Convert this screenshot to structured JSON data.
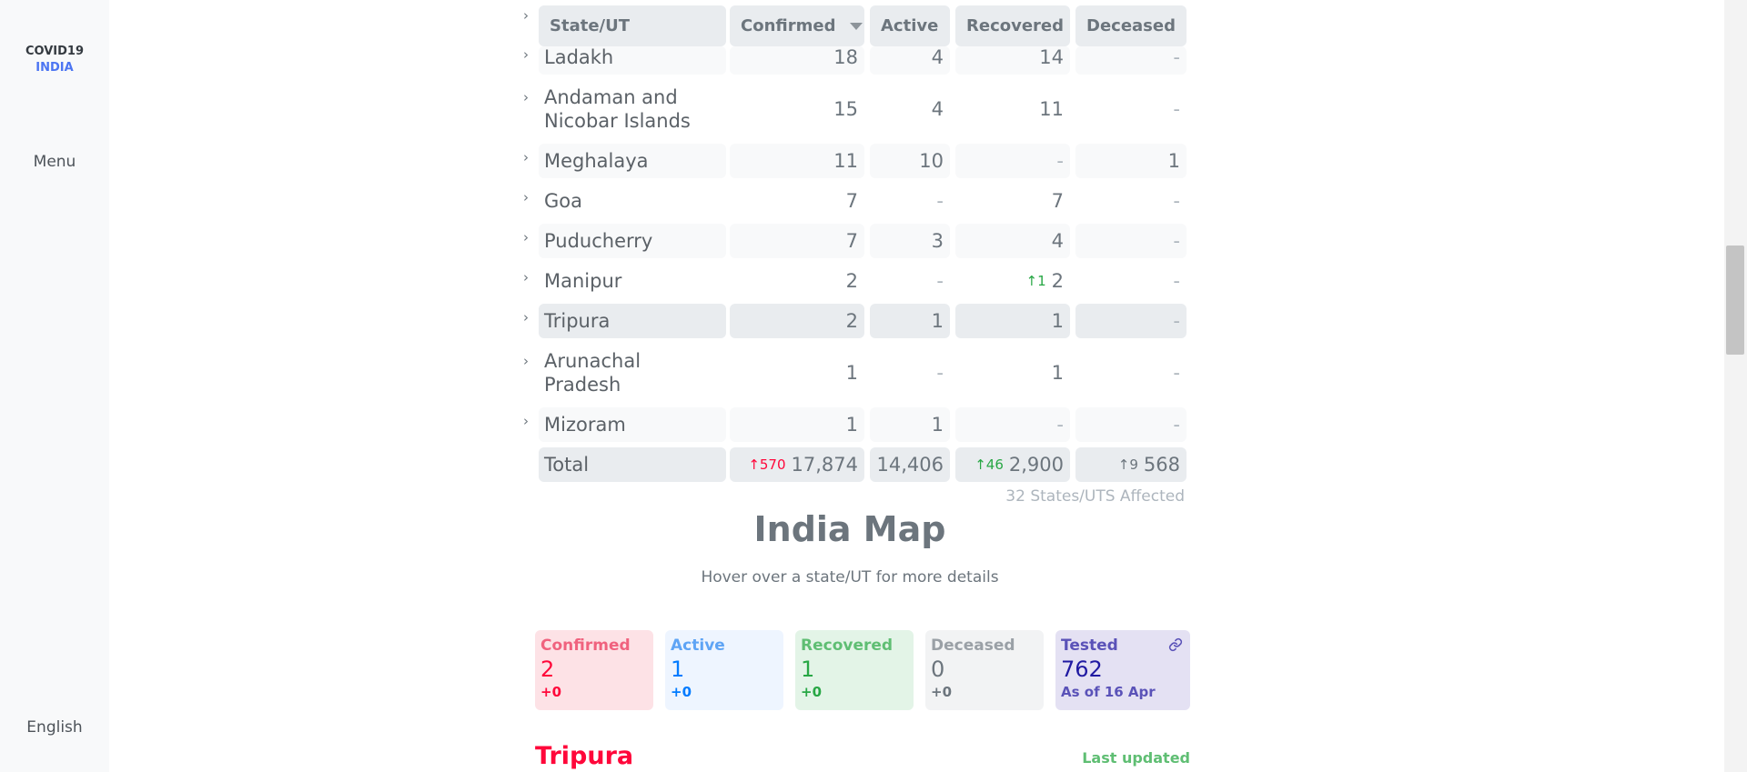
{
  "sidebar": {
    "brand_line1": "COVID19",
    "brand_line2": "INDIA",
    "menu_label": "Menu",
    "language_label": "English"
  },
  "table": {
    "headers": {
      "state": "State/UT",
      "confirmed": "Confirmed",
      "active": "Active",
      "recovered": "Recovered",
      "deceased": "Deceased"
    },
    "rows": [
      {
        "state": "Ladakh",
        "confirmed": "18",
        "active": "4",
        "recovered": "14",
        "deceased": "-"
      },
      {
        "state": "Andaman and Nicobar Islands",
        "confirmed": "15",
        "active": "4",
        "recovered": "11",
        "deceased": "-"
      },
      {
        "state": "Meghalaya",
        "confirmed": "11",
        "active": "10",
        "recovered": "-",
        "deceased": "1"
      },
      {
        "state": "Goa",
        "confirmed": "7",
        "active": "-",
        "recovered": "7",
        "deceased": "-"
      },
      {
        "state": "Puducherry",
        "confirmed": "7",
        "active": "3",
        "recovered": "4",
        "deceased": "-"
      },
      {
        "state": "Manipur",
        "confirmed": "2",
        "active": "-",
        "recovered": "2",
        "recovered_delta": "↑1",
        "deceased": "-"
      },
      {
        "state": "Tripura",
        "confirmed": "2",
        "active": "1",
        "recovered": "1",
        "deceased": "-"
      },
      {
        "state": "Arunachal Pradesh",
        "confirmed": "1",
        "active": "-",
        "recovered": "1",
        "deceased": "-"
      },
      {
        "state": "Mizoram",
        "confirmed": "1",
        "active": "1",
        "recovered": "-",
        "deceased": "-"
      }
    ],
    "total": {
      "label": "Total",
      "confirmed_delta": "↑570",
      "confirmed": "17,874",
      "active": "14,406",
      "recovered_delta": "↑46",
      "recovered": "2,900",
      "deceased_delta": "↑9",
      "deceased": "568"
    },
    "affected_note": "32 States/UTS Affected"
  },
  "map": {
    "title": "India Map",
    "subtitle": "Hover over a state/UT for more details"
  },
  "cards": {
    "confirmed": {
      "label": "Confirmed",
      "value": "2",
      "delta": "+0"
    },
    "active": {
      "label": "Active",
      "value": "1",
      "delta": "+0"
    },
    "recovered": {
      "label": "Recovered",
      "value": "1",
      "delta": "+0"
    },
    "deceased": {
      "label": "Deceased",
      "value": "0",
      "delta": "+0"
    },
    "tested": {
      "label": "Tested",
      "value": "762",
      "note": "As of 16 Apr"
    }
  },
  "selected_state": {
    "name": "Tripura",
    "last_updated_label": "Last updated"
  },
  "colors": {
    "confirmed": "#ff073a",
    "active": "#007bff",
    "recovered": "#28a745",
    "deceased": "#6c757d",
    "tested": "#201aa2",
    "brand_accent": "#4c75f2"
  }
}
